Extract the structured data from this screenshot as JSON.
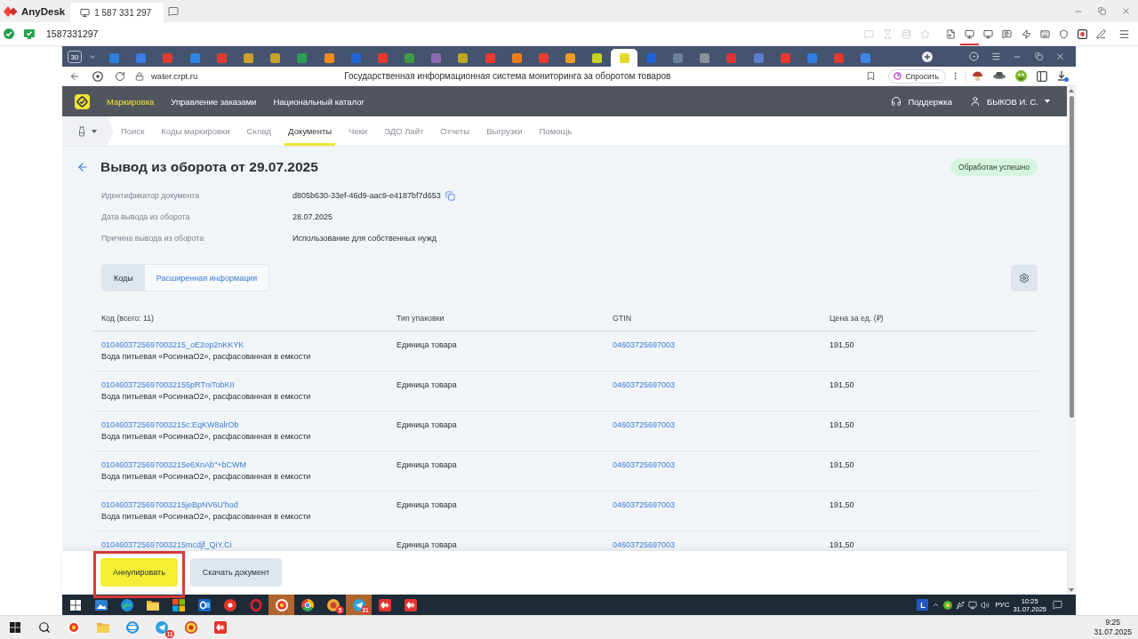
{
  "anydesk": {
    "app_name": "AnyDesk",
    "session_tab": "1 587 331 297",
    "address": "1587331297",
    "tools": [
      {
        "kind": "chat",
        "disabled": true,
        "selected": false
      },
      {
        "kind": "hourglass",
        "disabled": true,
        "selected": false
      },
      {
        "kind": "database",
        "disabled": true,
        "selected": false
      },
      {
        "kind": "star",
        "disabled": true,
        "selected": false
      },
      {
        "kind": "file",
        "disabled": false,
        "selected": false
      },
      {
        "kind": "display",
        "disabled": false,
        "selected": true
      },
      {
        "kind": "monitor",
        "disabled": false,
        "selected": false
      },
      {
        "kind": "message",
        "disabled": false,
        "selected": false
      },
      {
        "kind": "bolt",
        "disabled": false,
        "selected": false
      },
      {
        "kind": "keyboard",
        "disabled": false,
        "selected": false
      },
      {
        "kind": "shield",
        "disabled": false,
        "selected": false
      },
      {
        "kind": "record",
        "disabled": false,
        "selected": false
      },
      {
        "kind": "pen",
        "disabled": false,
        "selected": false
      }
    ]
  },
  "browser": {
    "tab_count": "30",
    "tabs": [
      {
        "color": "#2f7fe0",
        "selected": false
      },
      {
        "color": "#3d7be6",
        "selected": false
      },
      {
        "color": "#e23b30",
        "selected": false
      },
      {
        "color": "#2a86e8",
        "selected": false
      },
      {
        "color": "#e23b30",
        "selected": false
      },
      {
        "color": "#c9a12a",
        "selected": false
      },
      {
        "color": "#c9a12a",
        "selected": false
      },
      {
        "color": "#2e9e55",
        "selected": false
      },
      {
        "color": "#f08a1c",
        "selected": false
      },
      {
        "color": "#2166d6",
        "selected": false
      },
      {
        "color": "#ee3a2c",
        "selected": false
      },
      {
        "color": "#3f9a45",
        "selected": false
      },
      {
        "color": "#8c6bb0",
        "selected": false
      },
      {
        "color": "#b7aa22",
        "selected": false
      },
      {
        "color": "#ee3a2c",
        "selected": false
      },
      {
        "color": "#f07d1a",
        "selected": false
      },
      {
        "color": "#ee3a2c",
        "selected": false
      },
      {
        "color": "#f29b1f",
        "selected": false
      },
      {
        "color": "#c8d12a",
        "selected": false
      },
      {
        "color": "#e4d92a",
        "selected": true
      },
      {
        "color": "#1f63d2",
        "selected": false
      },
      {
        "color": "#6e7f99",
        "selected": false
      },
      {
        "color": "#8c9099",
        "selected": false
      },
      {
        "color": "#de3434",
        "selected": false
      },
      {
        "color": "#5d7cc9",
        "selected": false
      },
      {
        "color": "#ee3a2c",
        "selected": false
      },
      {
        "color": "#2f7fe0",
        "selected": false
      },
      {
        "color": "#e23b30",
        "selected": false
      },
      {
        "color": "#3d86e8",
        "selected": false
      }
    ],
    "url": "water.crpt.ru",
    "page_title": "Государственная информационная система мониторинга за оборотом товаров",
    "ask_button": "Спросить"
  },
  "app_header": {
    "menu": [
      {
        "label": "Маркировка",
        "selected": true
      },
      {
        "label": "Управление заказами",
        "selected": false
      },
      {
        "label": "Национальный каталог",
        "selected": false
      }
    ],
    "support": "Поддержка",
    "user": "БЫКОВ И. С."
  },
  "nav": {
    "items": [
      {
        "label": "Поиск",
        "selected": false
      },
      {
        "label": "Коды маркировки",
        "selected": false
      },
      {
        "label": "Склад",
        "selected": false
      },
      {
        "label": "Документы",
        "selected": true
      },
      {
        "label": "Чеки",
        "selected": false
      },
      {
        "label": "ЭДО Лайт",
        "selected": false
      },
      {
        "label": "Отчеты",
        "selected": false
      },
      {
        "label": "Выгрузки",
        "selected": false
      },
      {
        "label": "Помощь",
        "selected": false
      }
    ]
  },
  "document": {
    "title": "Вывод из оборота от 29.07.2025",
    "status": "Обработан успешно",
    "fields": [
      {
        "label": "Идентификатор документа",
        "value": "d805b630-33ef-46d9-aac9-e4187bf7d653",
        "copyable": true
      },
      {
        "label": "Дата вывода из оборота",
        "value": "28.07.2025",
        "copyable": false
      },
      {
        "label": "Причина вывода из оборота",
        "value": "Использование для собственных нужд",
        "copyable": false
      }
    ]
  },
  "view_tabs": [
    {
      "label": "Коды",
      "selected": true
    },
    {
      "label": "Расширенная информация",
      "selected": false
    }
  ],
  "table": {
    "columns": [
      "Код (всего: 11)",
      "Тип упаковки",
      "GTIN",
      "Цена за ед. (₽)"
    ],
    "rows": [
      {
        "code": "0104603725697003215_oE2op2nKKYK",
        "description": "Вода питьевая «РосинкаО2», расфасованная в емкости",
        "package": "Единица товара",
        "gtin": "04603725697003",
        "price": "191,50"
      },
      {
        "code": "01046037256970032155pRTniTobKII",
        "description": "Вода питьевая «РосинкаО2», расфасованная в емкости",
        "package": "Единица товара",
        "gtin": "04603725697003",
        "price": "191,50"
      },
      {
        "code": "0104603725697003215c:EqKW8alrOb",
        "description": "Вода питьевая «РосинкаО2», расфасованная в емкости",
        "package": "Единица товара",
        "gtin": "04603725697003",
        "price": "191,50"
      },
      {
        "code": "0104603725697003215e6XnAb\"+bCWM",
        "description": "Вода питьевая «РосинкаО2», расфасованная в емкости",
        "package": "Единица товара",
        "gtin": "04603725697003",
        "price": "191,50"
      },
      {
        "code": "0104603725697003215jeBpNV6U'hod",
        "description": "Вода питьевая «РосинкаО2», расфасованная в емкости",
        "package": "Единица товара",
        "gtin": "04603725697003",
        "price": "191,50"
      },
      {
        "code": "0104603725697003215mcdjf_QiY.Ci",
        "package": "Единица товара",
        "gtin": "04603725697003",
        "price": "191,50"
      }
    ]
  },
  "actions": [
    {
      "label": "Аннулировать",
      "kind": "primary",
      "highlighted": true
    },
    {
      "label": "Скачать документ",
      "kind": "secondary",
      "highlighted": false
    }
  ],
  "remote_taskbar": {
    "apps": [
      {
        "kind": "start",
        "highlighted": false
      },
      {
        "kind": "picture",
        "highlighted": false
      },
      {
        "kind": "swirl",
        "highlighted": false
      },
      {
        "kind": "folder",
        "highlighted": false
      },
      {
        "kind": "tiles",
        "highlighted": false
      },
      {
        "kind": "mail",
        "highlighted": false
      },
      {
        "kind": "disc",
        "highlighted": false
      },
      {
        "kind": "ring",
        "highlighted": false
      },
      {
        "kind": "browser",
        "highlighted": true
      },
      {
        "kind": "wheel",
        "highlighted": false
      },
      {
        "kind": "round",
        "highlighted": false,
        "badge": "5"
      },
      {
        "kind": "plane",
        "highlighted": true,
        "badge": "31"
      },
      {
        "kind": "diamond",
        "highlighted": false
      },
      {
        "kind": "diamond",
        "highlighted": false
      }
    ],
    "keyboard_app": "L",
    "language": "РУС",
    "time": "10:25",
    "date": "31.07.2025"
  },
  "local_taskbar": {
    "apps": [
      {
        "kind": "start"
      },
      {
        "kind": "search"
      },
      {
        "kind": "browser"
      },
      {
        "kind": "folder"
      },
      {
        "kind": "globe"
      },
      {
        "kind": "plane",
        "badge": "11"
      },
      {
        "kind": "coin"
      },
      {
        "kind": "diamond"
      }
    ],
    "time": "9:25",
    "date": "31.07.2025"
  }
}
